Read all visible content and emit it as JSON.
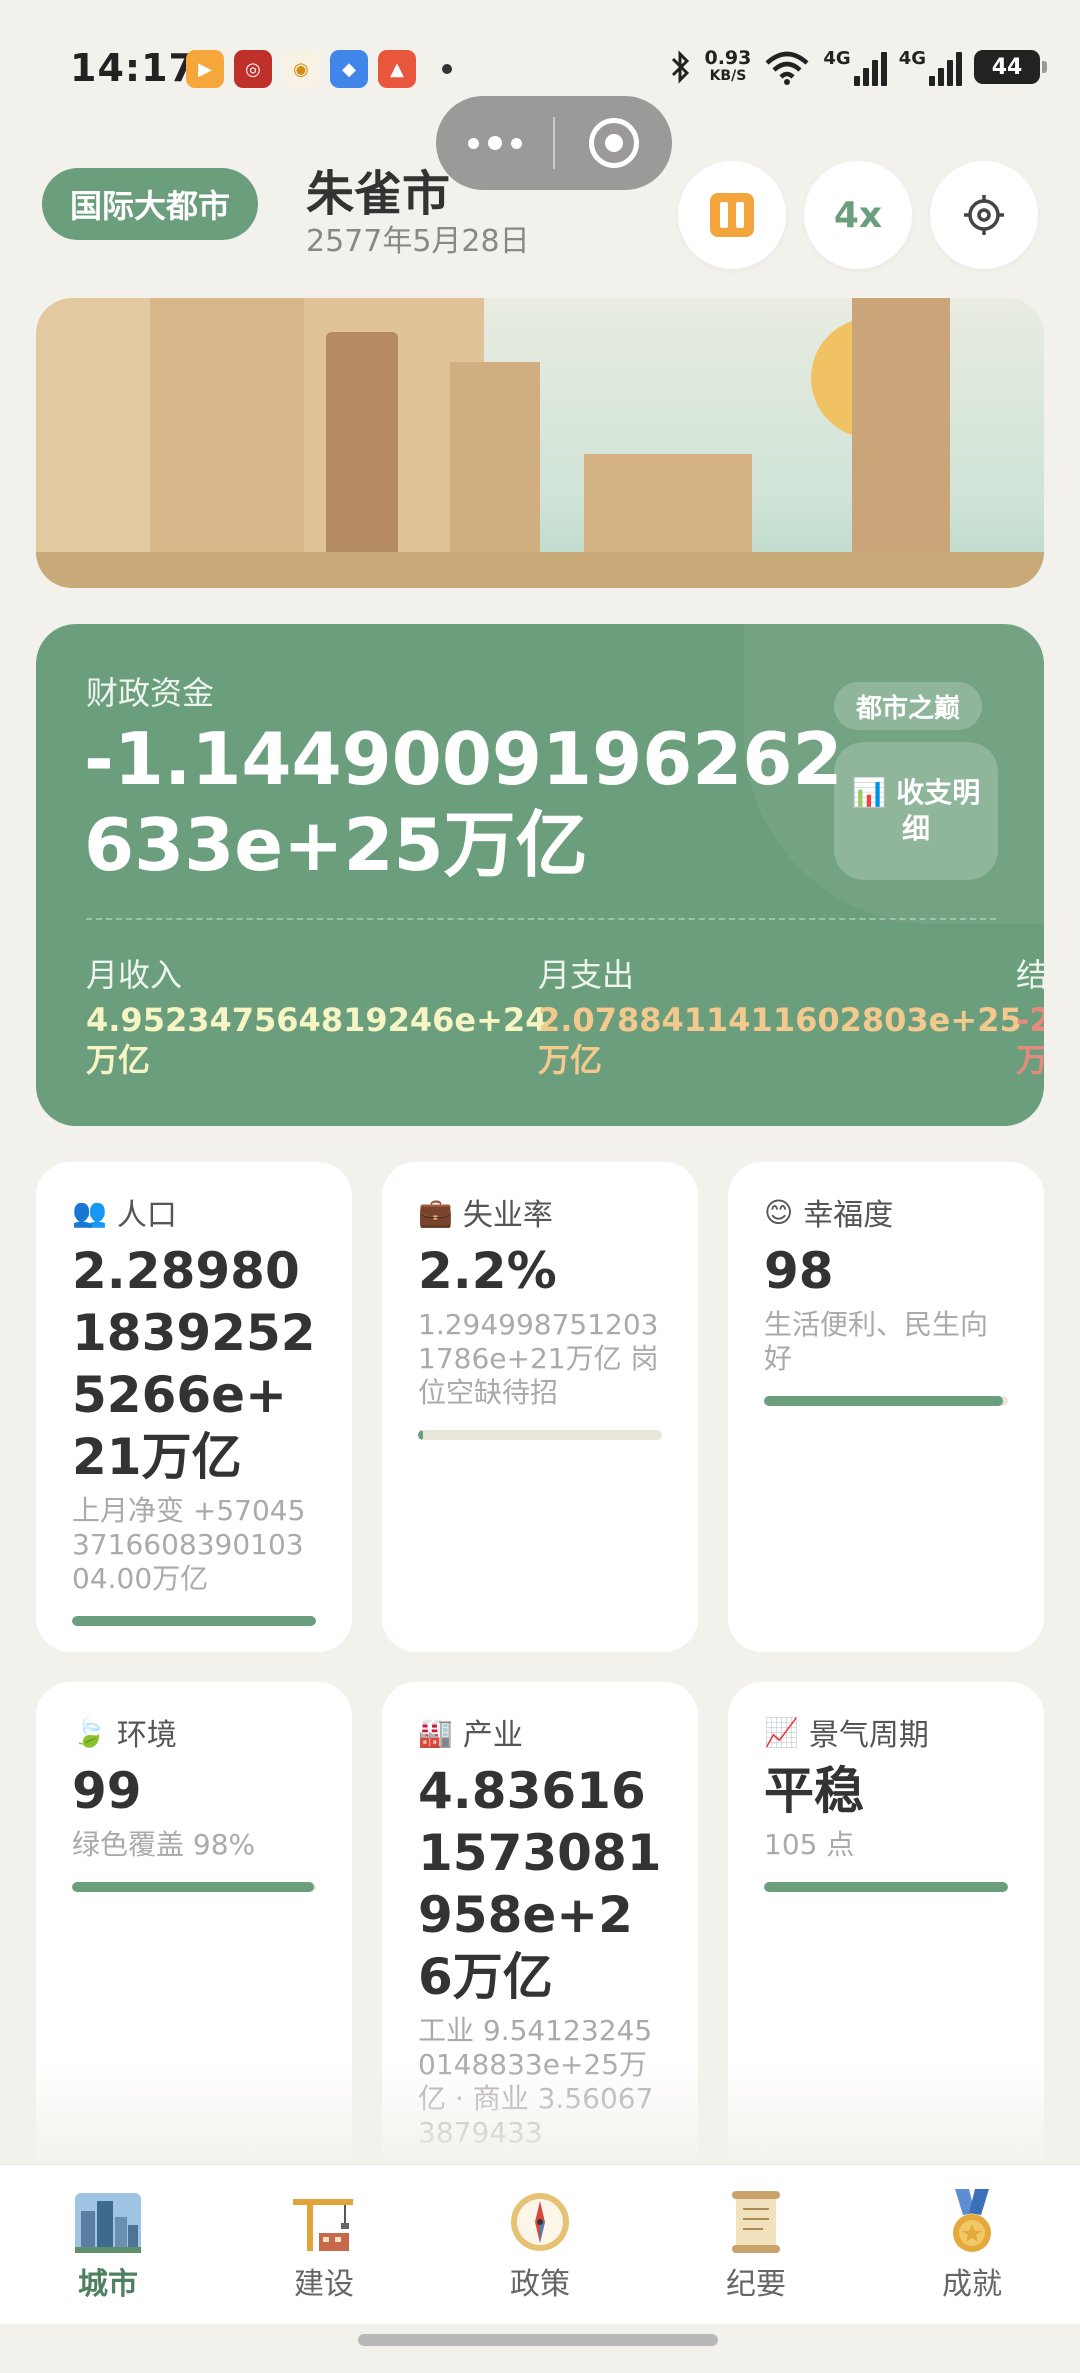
{
  "status": {
    "time": "14:17",
    "net_speed_value": "0.93",
    "net_speed_unit": "KB/S",
    "signal1": "4G",
    "signal2": "4G",
    "battery": "44"
  },
  "header": {
    "badge": "国际大都市",
    "city": "朱雀市",
    "date": "2577年5月28日",
    "speed": "4x"
  },
  "finance": {
    "label": "财政资金",
    "value": "-1.1449009196262633e+25万亿",
    "tag": "都市之巅",
    "detail_icon": "📊",
    "detail_label": "收支明细",
    "income_label": "月收入",
    "income_value": "4.952347564819246e+24",
    "income_unit": "万亿",
    "expense_label": "月支出",
    "expense_value": "2.0788411411602803e+25",
    "expense_unit": "万亿",
    "balance_label": "结",
    "balance_value": "-2",
    "balance_unit": "万"
  },
  "cards": {
    "population": {
      "icon": "👥",
      "label": "人口",
      "value": "2.289801839252526​6e+21万亿",
      "sub": "上月净变 +57045371660839010304.00万亿",
      "progress": 1.0
    },
    "unemployment": {
      "icon": "💼",
      "label": "失业率",
      "value": "2.2%",
      "sub": "1.2949987512031786e+21万亿 岗位空缺待招",
      "progress": 0.022
    },
    "happiness": {
      "icon": "😊",
      "label": "幸福度",
      "value": "98",
      "sub": "生活便利、民生向好",
      "progress": 0.98
    },
    "environment": {
      "icon": "🍃",
      "label": "环境",
      "value": "99",
      "sub": "绿色覆盖 98%",
      "progress": 0.99
    },
    "industry": {
      "icon": "🏭",
      "label": "产业",
      "value": "4.836161573081958e+26万亿",
      "sub": "工业 9.541232450148833e+25万亿 · 商业 3.560673879433"
    },
    "cycle": {
      "icon": "📈",
      "label": "景气周期",
      "value": "平稳",
      "sub": "105 点",
      "progress": 1.0
    }
  },
  "nav": {
    "items": [
      {
        "label": "城市",
        "icon": "city-icon"
      },
      {
        "label": "建设",
        "icon": "crane-icon"
      },
      {
        "label": "政策",
        "icon": "compass-icon"
      },
      {
        "label": "纪要",
        "icon": "scroll-icon"
      },
      {
        "label": "成就",
        "icon": "medal-icon"
      }
    ]
  },
  "colors": {
    "accent": "#6b9e7c",
    "background": "#f3f1ec",
    "pause": "#f2a53b",
    "income": "#f7f5c4",
    "expense": "#f3c98e",
    "balance": "#e58a7c"
  }
}
